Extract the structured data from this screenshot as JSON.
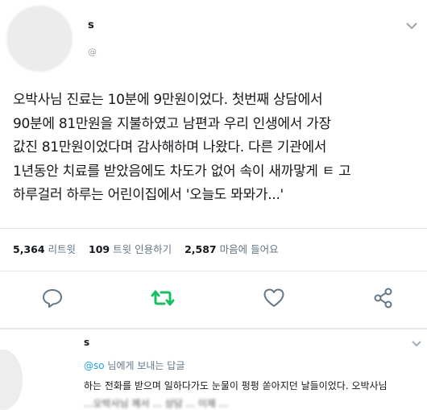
{
  "tweet": {
    "user_name": "s",
    "user_handle": "@",
    "lines": [
      "오박사님 진료는 10분에 9만원이었다. 첫번째 상담에서",
      "90분에 81만원을 지불하였고 남편과 우리 인생에서 가장",
      "값진 81만원이었다며 감사해하며 나왔다. 다른 기관에서",
      "1년동안 치료를 받았음에도 차도가 없어 속이 새까맣게 ㅌ 고",
      "하루걸러 하루는 어린이집에서 '오늘도 뫄뫄가...'"
    ],
    "stats": {
      "retweet_count": "5,364",
      "retweet_label": "리트윗",
      "quote_count": "109",
      "quote_label": "트윗 인용하기",
      "like_count": "2,587",
      "like_label": "마음에 들어요"
    },
    "actions": {
      "reply_icon": "comment-icon",
      "retweet_icon": "retweet-icon",
      "like_icon": "heart-icon",
      "share_icon": "share-icon",
      "retweet_color": "#17bf63",
      "icon_color": "#657786"
    }
  },
  "reply": {
    "user_name": "s",
    "reply_to_handle": "@so",
    "reply_to_suffix": " 님에게 보내는 답글",
    "text": "하는 전화를 받으며 일하다가도 눈물이 펑펑 쏟아지던 날들이었다. 오박사님",
    "text_partial": "...오박사님 께서 ... 상담 ... 이제 ..."
  }
}
